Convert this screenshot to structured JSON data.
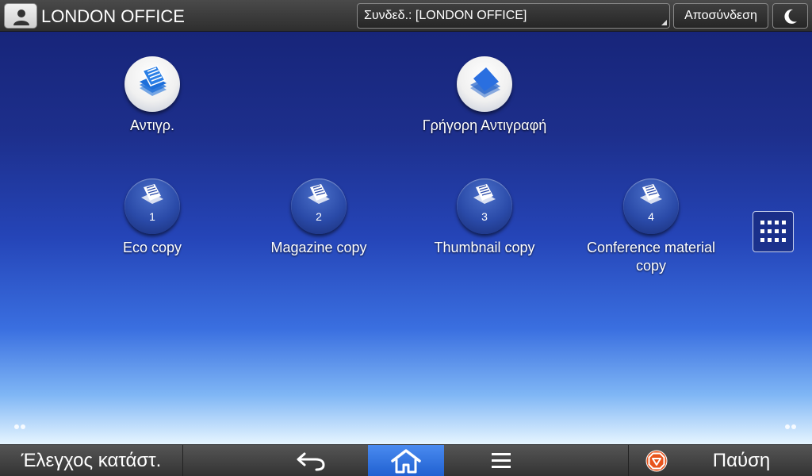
{
  "header": {
    "office_name": "LONDON OFFICE",
    "login_select_value": "Συνδεδ.: [LONDON OFFICE]",
    "logout_label": "Αποσύνδεση",
    "user_icon": "user-icon",
    "sleep_icon": "moon-icon"
  },
  "apps": [
    {
      "label": "Αντιγρ.",
      "icon": "copy-document-icon"
    },
    {
      "label": "Γρήγορη Αντιγραφή",
      "icon": "quick-copy-icon"
    },
    {
      "label": "Eco copy",
      "number": "1",
      "icon": "copy-program-icon"
    },
    {
      "label": "Magazine copy",
      "number": "2",
      "icon": "copy-program-icon"
    },
    {
      "label": "Thumbnail copy",
      "number": "3",
      "icon": "copy-program-icon"
    },
    {
      "label": "Conference material copy",
      "number": "4",
      "icon": "copy-program-icon"
    }
  ],
  "app_list_icon": "grid-icon",
  "footer": {
    "status_check_label": "Έλεγχος κατάστ.",
    "pause_label": "Παύση",
    "back_icon": "back-arrow-icon",
    "home_icon": "home-icon",
    "menu_icon": "menu-icon",
    "stop_icon": "stop-icon"
  },
  "colors": {
    "home_active": "#2f73e0",
    "stop_orange": "#e8541c"
  }
}
